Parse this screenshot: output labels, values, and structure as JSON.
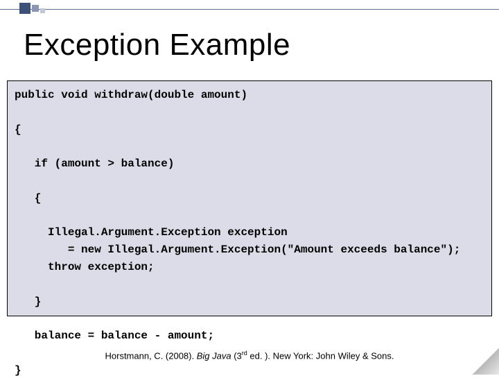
{
  "title": "Exception Example",
  "code": {
    "l1": "public void withdraw(double amount)",
    "l2": "{",
    "l3": "   if (amount > balance)",
    "l4": "   {",
    "l5": "     Illegal.Argument.Exception exception",
    "l6": "        = new Illegal.Argument.Exception(\"Amount exceeds balance\");",
    "l7": "     throw exception;",
    "l8": "   }",
    "l9": "   balance = balance - amount;",
    "l10": "}"
  },
  "citation": {
    "author": "Horstmann, C. (2008). ",
    "book": "Big Java",
    "edition_pre": " (3",
    "edition_sup": "rd",
    "edition_post": " ed. ). New York: John Wiley & Sons."
  }
}
